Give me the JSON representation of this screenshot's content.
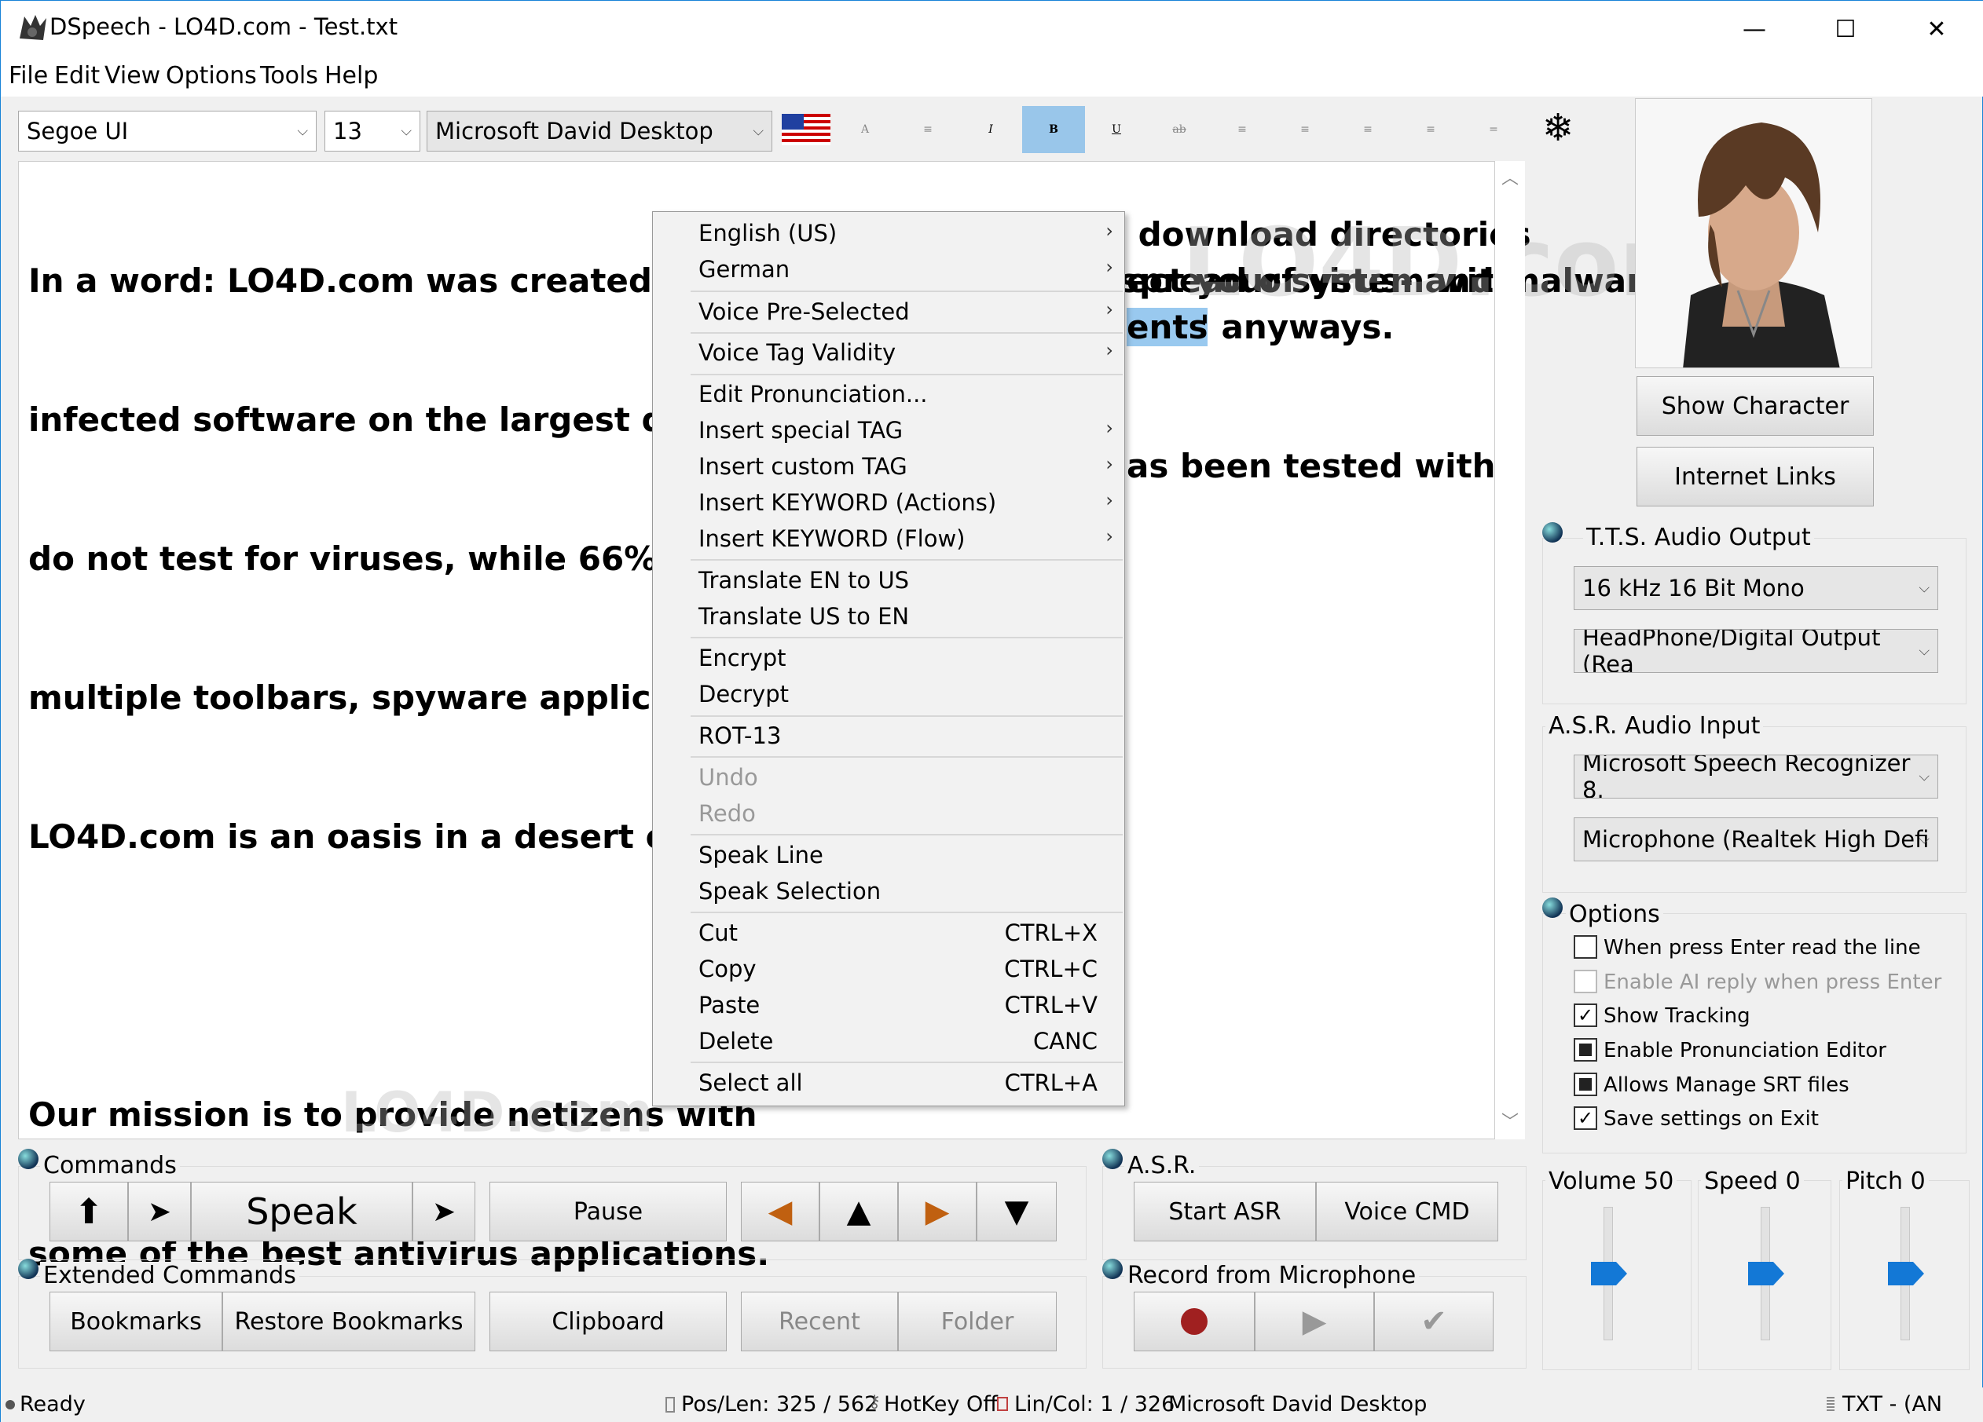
{
  "window": {
    "title": "DSpeech - LO4D.com - Test.txt",
    "minimize": "—",
    "maximize": "☐",
    "close": "✕"
  },
  "menu": [
    "File",
    "Edit",
    "View",
    "Options",
    "Tools",
    "Help"
  ],
  "toolbar": {
    "font": "Segoe UI",
    "size": "13",
    "voice": "Microsoft David Desktop",
    "flag_icon": "us-flag-icon",
    "freeze_icon": "snowflake-icon"
  },
  "editor": {
    "lines": [
      "In a word: LO4D.com was created because of the rampant spread of virus- and malware-",
      "infected software on the largest downlo",
      "do not test for viruses, while 66% of the",
      "multiple toolbars, spyware applications",
      "LO4D.com is an oasis in a desert of a ve",
      "",
      "Our mission is to provide netizens with",
      "some of the best antivirus applications."
    ],
    "right_fragments": [
      " download directories",
      "ect your system with",
      "ents",
      "' anyways.",
      "as been tested with"
    ]
  },
  "context_menu": {
    "items": [
      {
        "label": "English (US)",
        "sub": "›"
      },
      {
        "label": "German",
        "sub": "›"
      },
      {
        "label": "Voice Pre-Selected",
        "sub": "›"
      },
      {
        "label": "Voice Tag Validity",
        "sub": "›"
      },
      {
        "label": "Edit Pronunciation..."
      },
      {
        "label": "Insert special TAG",
        "sub": "›"
      },
      {
        "label": "Insert custom TAG",
        "sub": "›"
      },
      {
        "label": "Insert KEYWORD (Actions)",
        "sub": "›"
      },
      {
        "label": "Insert KEYWORD (Flow)",
        "sub": "›"
      },
      {
        "label": "Translate EN to US"
      },
      {
        "label": "Translate US to EN"
      },
      {
        "label": "Encrypt"
      },
      {
        "label": "Decrypt"
      },
      {
        "label": "ROT-13"
      },
      {
        "label": "Undo"
      },
      {
        "label": "Redo"
      },
      {
        "label": "Speak Line"
      },
      {
        "label": "Speak Selection"
      },
      {
        "label": "Cut",
        "shortcut": "CTRL+X"
      },
      {
        "label": "Copy",
        "shortcut": "CTRL+C"
      },
      {
        "label": "Paste",
        "shortcut": "CTRL+V"
      },
      {
        "label": "Delete",
        "shortcut": "CANC"
      },
      {
        "label": "Select all",
        "shortcut": "CTRL+A"
      }
    ]
  },
  "right_panel": {
    "show_character": "Show Character",
    "internet_links": "Internet Links",
    "tts_title": "T.T.S. Audio Output",
    "tts_format": "16 kHz 16 Bit Mono",
    "tts_device": "HeadPhone/Digital Output (Rea",
    "asr_title": "A.S.R. Audio Input",
    "asr_engine": "Microsoft Speech Recognizer 8.",
    "asr_device": "Microphone (Realtek High Defi",
    "options_title": "Options",
    "options": [
      {
        "label": "When press Enter read the line",
        "state": "unchecked"
      },
      {
        "label": "Enable AI reply when press Enter",
        "state": "disabled"
      },
      {
        "label": "Show Tracking",
        "state": "checked"
      },
      {
        "label": "Enable Pronunciation Editor",
        "state": "square"
      },
      {
        "label": "Allows Manage SRT files",
        "state": "square"
      },
      {
        "label": "Save settings on Exit",
        "state": "checked"
      }
    ],
    "volume": "Volume 50",
    "speed": "Speed 0",
    "pitch": "Pitch 0"
  },
  "sliders": {
    "volume": 50,
    "speed": 0,
    "pitch": 0
  },
  "commands": {
    "title": "Commands",
    "speak": "Speak",
    "pause": "Pause",
    "ext_title": "Extended Commands",
    "bookmarks": "Bookmarks",
    "restore_bookmarks": "Restore Bookmarks",
    "clipboard": "Clipboard",
    "recent": "Recent",
    "folder": "Folder"
  },
  "asr": {
    "title": "A.S.R.",
    "start": "Start ASR",
    "voice_cmd": "Voice CMD",
    "record_title": "Record from Microphone"
  },
  "status": {
    "ready": "Ready",
    "poslen": "Pos/Len: 325 / 562",
    "hotkey": "HotKey Off",
    "lincol": "Lin/Col: 1 / 326",
    "voice": "Microsoft David Desktop",
    "mode": "TXT - (AN"
  },
  "watermark": "LO4D.com"
}
